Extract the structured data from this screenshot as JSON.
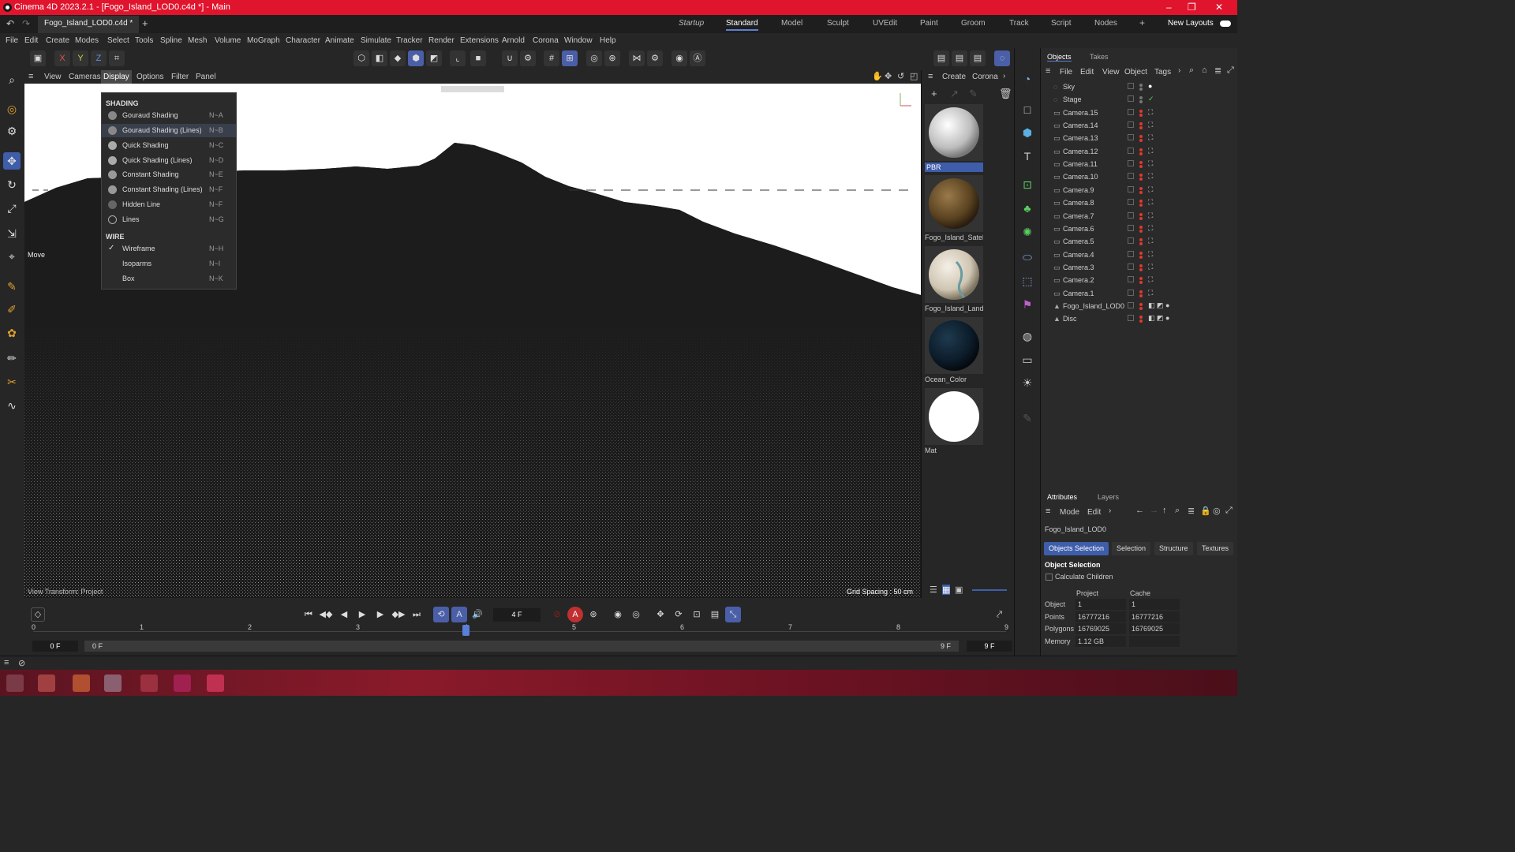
{
  "app": {
    "title": "Cinema 4D 2023.2.1 - [Fogo_Island_LOD0.c4d *] - Main",
    "doc_tab": "Fogo_Island_LOD0.c4d *",
    "new_tab": "+"
  },
  "window_controls": {
    "minimize": "–",
    "restore": "❐",
    "close": "✕"
  },
  "layouts": [
    "Startup",
    "Standard",
    "Model",
    "Sculpt",
    "UVEdit",
    "Paint",
    "Groom",
    "Track",
    "Script",
    "Nodes"
  ],
  "layouts_add": "+",
  "new_layouts": "New Layouts",
  "menu": [
    "File",
    "Edit",
    "Create",
    "Modes",
    "Select",
    "Tools",
    "Spline",
    "Mesh",
    "Volume",
    "MoGraph",
    "Character",
    "Animate",
    "Simulate",
    "Tracker",
    "Render",
    "Extensions",
    "Arnold",
    "Corona",
    "Window",
    "Help"
  ],
  "axis_buttons": [
    "X",
    "Y",
    "Z"
  ],
  "viewport_menu": [
    "View",
    "Cameras",
    "Display",
    "Options",
    "Filter",
    "Panel"
  ],
  "viewport": {
    "tool_label": "Move",
    "footer_left": "View Transform: Project",
    "grid_spacing": "Grid Spacing : 50 cm"
  },
  "display_menu": {
    "shading_header": "SHADING",
    "shading": [
      {
        "label": "Gouraud Shading",
        "shortcut": "N~A"
      },
      {
        "label": "Gouraud Shading (Lines)",
        "shortcut": "N~B"
      },
      {
        "label": "Quick Shading",
        "shortcut": "N~C"
      },
      {
        "label": "Quick Shading (Lines)",
        "shortcut": "N~D"
      },
      {
        "label": "Constant Shading",
        "shortcut": "N~E"
      },
      {
        "label": "Constant Shading (Lines)",
        "shortcut": "N~F"
      },
      {
        "label": "Hidden Line",
        "shortcut": "N~F"
      },
      {
        "label": "Lines",
        "shortcut": "N~G"
      }
    ],
    "wire_header": "WIRE",
    "wire": [
      {
        "label": "Wireframe",
        "shortcut": "N~H",
        "checked": "✓"
      },
      {
        "label": "Isoparms",
        "shortcut": "N~I"
      },
      {
        "label": "Box",
        "shortcut": "N~K"
      }
    ]
  },
  "material_panel": {
    "menu": [
      "Create",
      "Corona"
    ],
    "materials": [
      "PBR",
      "Fogo_Island_Satel",
      "Fogo_Island_Land",
      "Ocean_Color",
      "Mat"
    ]
  },
  "objects_panel": {
    "tabs": [
      "Objects",
      "Takes"
    ],
    "menu": [
      "File",
      "Edit",
      "View",
      "Object",
      "Tags"
    ],
    "objects": [
      "Sky",
      "Stage",
      "Camera.15",
      "Camera.14",
      "Camera.13",
      "Camera.12",
      "Camera.11",
      "Camera.10",
      "Camera.9",
      "Camera.8",
      "Camera.7",
      "Camera.6",
      "Camera.5",
      "Camera.4",
      "Camera.3",
      "Camera.2",
      "Camera.1",
      "Fogo_Island_LOD0",
      "Disc"
    ]
  },
  "attributes_panel": {
    "tabs": [
      "Attributes",
      "Layers"
    ],
    "menu": [
      "Mode",
      "Edit"
    ],
    "object_name": "Fogo_Island_LOD0",
    "sub_tabs": [
      "Objects Selection",
      "Selection",
      "Structure",
      "Textures"
    ],
    "section": "Object Selection",
    "calc_children": "Calculate Children",
    "col_project": "Project",
    "col_cache": "Cache",
    "rows": [
      {
        "label": "Object",
        "project": "1",
        "cache": "1"
      },
      {
        "label": "Points",
        "project": "16777216",
        "cache": "16777216"
      },
      {
        "label": "Polygons",
        "project": "16769025",
        "cache": "16769025"
      },
      {
        "label": "Memory",
        "project": "1.12 GB",
        "cache": ""
      }
    ]
  },
  "timeline": {
    "current_frame": "4 F",
    "ruler": [
      "0",
      "1",
      "2",
      "3",
      "4",
      "5",
      "6",
      "7",
      "8",
      "9"
    ],
    "start": "0 F",
    "range_start": "0 F",
    "range_end": "9 F",
    "end": "9 F",
    "current_value": 4,
    "max": 9
  }
}
